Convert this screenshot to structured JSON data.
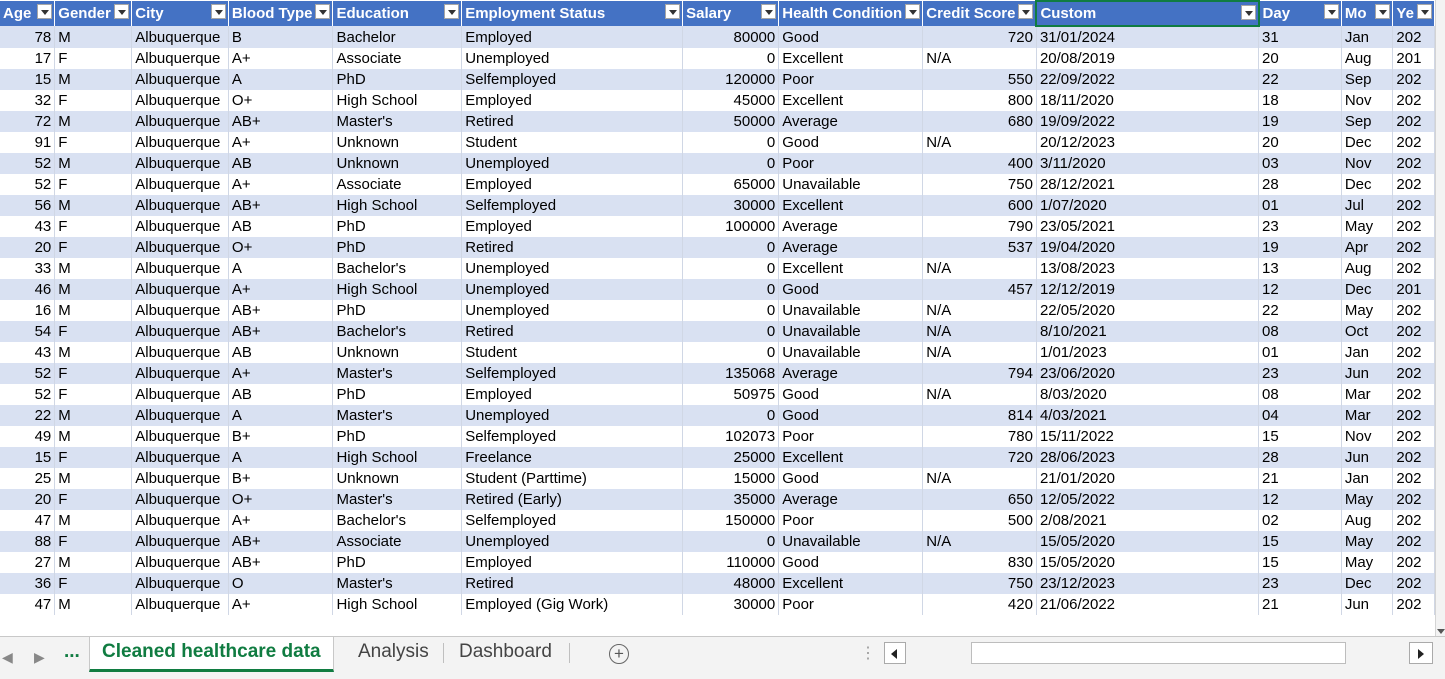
{
  "columns": [
    {
      "key": "age",
      "label": "Age",
      "width": 55
    },
    {
      "key": "gender",
      "label": "Gender",
      "width": 77
    },
    {
      "key": "city",
      "label": "City",
      "width": 97
    },
    {
      "key": "blood",
      "label": "Blood Type",
      "width": 102
    },
    {
      "key": "edu",
      "label": "Education",
      "width": 131
    },
    {
      "key": "emp",
      "label": "Employment Status",
      "width": 225
    },
    {
      "key": "salary",
      "label": "Salary",
      "width": 98
    },
    {
      "key": "health",
      "label": "Health Condition",
      "width": 143
    },
    {
      "key": "credit",
      "label": "Credit Score",
      "width": 108
    },
    {
      "key": "custom",
      "label": "Custom",
      "width": 232
    },
    {
      "key": "day",
      "label": "Day",
      "width": 85
    },
    {
      "key": "mon",
      "label": "Mo",
      "width": 52
    },
    {
      "key": "year",
      "label": "Ye",
      "width": 30
    }
  ],
  "rows": [
    [
      "78",
      "M",
      "Albuquerque",
      "B",
      "Bachelor",
      "Employed",
      "80000",
      "Good",
      "720",
      "31/01/2024",
      "31",
      "Jan",
      "202"
    ],
    [
      "17",
      "F",
      "Albuquerque",
      "A+",
      "Associate",
      "Unemployed",
      "0",
      "Excellent",
      "N/A",
      "20/08/2019",
      "20",
      "Aug",
      "201"
    ],
    [
      "15",
      "M",
      "Albuquerque",
      "A",
      "PhD",
      "Selfemployed",
      "120000",
      "Poor",
      "550",
      "22/09/2022",
      "22",
      "Sep",
      "202"
    ],
    [
      "32",
      "F",
      "Albuquerque",
      "O+",
      "High School",
      "Employed",
      "45000",
      "Excellent",
      "800",
      "18/11/2020",
      "18",
      "Nov",
      "202"
    ],
    [
      "72",
      "M",
      "Albuquerque",
      "AB+",
      "Master's",
      "Retired",
      "50000",
      "Average",
      "680",
      "19/09/2022",
      "19",
      "Sep",
      "202"
    ],
    [
      "91",
      "F",
      "Albuquerque",
      "A+",
      "Unknown",
      "Student",
      "0",
      "Good",
      "N/A",
      "20/12/2023",
      "20",
      "Dec",
      "202"
    ],
    [
      "52",
      "M",
      "Albuquerque",
      "AB",
      "Unknown",
      "Unemployed",
      "0",
      "Poor",
      "400",
      "3/11/2020",
      "03",
      "Nov",
      "202"
    ],
    [
      "52",
      "F",
      "Albuquerque",
      "A+",
      "Associate",
      "Employed",
      "65000",
      "Unavailable",
      "750",
      "28/12/2021",
      "28",
      "Dec",
      "202"
    ],
    [
      "56",
      "M",
      "Albuquerque",
      "AB+",
      "High School",
      "Selfemployed",
      "30000",
      "Excellent",
      "600",
      "1/07/2020",
      "01",
      "Jul",
      "202"
    ],
    [
      "43",
      "F",
      "Albuquerque",
      "AB",
      "PhD",
      "Employed",
      "100000",
      "Average",
      "790",
      "23/05/2021",
      "23",
      "May",
      "202"
    ],
    [
      "20",
      "F",
      "Albuquerque",
      "O+",
      "PhD",
      "Retired",
      "0",
      "Average",
      "537",
      "19/04/2020",
      "19",
      "Apr",
      "202"
    ],
    [
      "33",
      "M",
      "Albuquerque",
      "A",
      "Bachelor's",
      "Unemployed",
      "0",
      "Excellent",
      "N/A",
      "13/08/2023",
      "13",
      "Aug",
      "202"
    ],
    [
      "46",
      "M",
      "Albuquerque",
      "A+",
      "High School",
      "Unemployed",
      "0",
      "Good",
      "457",
      "12/12/2019",
      "12",
      "Dec",
      "201"
    ],
    [
      "16",
      "M",
      "Albuquerque",
      "AB+",
      "PhD",
      "Unemployed",
      "0",
      "Unavailable",
      "N/A",
      "22/05/2020",
      "22",
      "May",
      "202"
    ],
    [
      "54",
      "F",
      "Albuquerque",
      "AB+",
      "Bachelor's",
      "Retired",
      "0",
      "Unavailable",
      "N/A",
      "8/10/2021",
      "08",
      "Oct",
      "202"
    ],
    [
      "43",
      "M",
      "Albuquerque",
      "AB",
      "Unknown",
      "Student",
      "0",
      "Unavailable",
      "N/A",
      "1/01/2023",
      "01",
      "Jan",
      "202"
    ],
    [
      "52",
      "F",
      "Albuquerque",
      "A+",
      "Master's",
      "Selfemployed",
      "135068",
      "Average",
      "794",
      "23/06/2020",
      "23",
      "Jun",
      "202"
    ],
    [
      "52",
      "F",
      "Albuquerque",
      "AB",
      "PhD",
      "Employed",
      "50975",
      "Good",
      "N/A",
      "8/03/2020",
      "08",
      "Mar",
      "202"
    ],
    [
      "22",
      "M",
      "Albuquerque",
      "A",
      "Master's",
      "Unemployed",
      "0",
      "Good",
      "814",
      "4/03/2021",
      "04",
      "Mar",
      "202"
    ],
    [
      "49",
      "M",
      "Albuquerque",
      "B+",
      "PhD",
      "Selfemployed",
      "102073",
      "Poor",
      "780",
      "15/11/2022",
      "15",
      "Nov",
      "202"
    ],
    [
      "15",
      "F",
      "Albuquerque",
      "A",
      "High School",
      "Freelance",
      "25000",
      "Excellent",
      "720",
      "28/06/2023",
      "28",
      "Jun",
      "202"
    ],
    [
      "25",
      "M",
      "Albuquerque",
      "B+",
      "Unknown",
      "Student (Parttime)",
      "15000",
      "Good",
      "N/A",
      "21/01/2020",
      "21",
      "Jan",
      "202"
    ],
    [
      "20",
      "F",
      "Albuquerque",
      "O+",
      "Master's",
      "Retired (Early)",
      "35000",
      "Average",
      "650",
      "12/05/2022",
      "12",
      "May",
      "202"
    ],
    [
      "47",
      "M",
      "Albuquerque",
      "A+",
      "Bachelor's",
      "Selfemployed",
      "150000",
      "Poor",
      "500",
      "2/08/2021",
      "02",
      "Aug",
      "202"
    ],
    [
      "88",
      "F",
      "Albuquerque",
      "AB+",
      "Associate",
      "Unemployed",
      "0",
      "Unavailable",
      "N/A",
      "15/05/2020",
      "15",
      "May",
      "202"
    ],
    [
      "27",
      "M",
      "Albuquerque",
      "AB+",
      "PhD",
      "Employed",
      "110000",
      "Good",
      "830",
      "15/05/2020",
      "15",
      "May",
      "202"
    ],
    [
      "36",
      "F",
      "Albuquerque",
      "O",
      "Master's",
      "Retired",
      "48000",
      "Excellent",
      "750",
      "23/12/2023",
      "23",
      "Dec",
      "202"
    ],
    [
      "47",
      "M",
      "Albuquerque",
      "A+",
      "High School",
      "Employed (Gig Work)",
      "30000",
      "Poor",
      "420",
      "21/06/2022",
      "21",
      "Jun",
      "202"
    ]
  ],
  "sheet_tabs": {
    "ellipsis": "...",
    "tabs": [
      "Cleaned healthcare data",
      "Analysis",
      "Dashboard"
    ],
    "active_index": 0,
    "add_label": "+"
  },
  "icons": {
    "filter": "filter-dropdown-icon",
    "add": "add-sheet-icon",
    "nav_prev": "prev-sheet-arrow-icon",
    "nav_next": "next-sheet-arrow-icon"
  },
  "colors": {
    "header_bg": "#4472c4",
    "band_odd": "#d9e1f2",
    "band_even": "#ffffff",
    "active_tab": "#107c41"
  }
}
